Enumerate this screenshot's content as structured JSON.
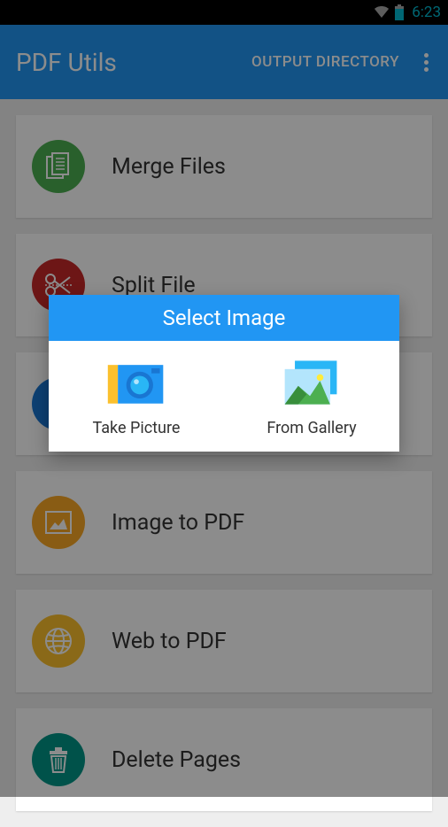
{
  "status": {
    "time": "6:23"
  },
  "header": {
    "title": "PDF Utils",
    "output_directory": "OUTPUT DIRECTORY"
  },
  "menu": {
    "items": [
      {
        "label": "Merge Files",
        "icon_color": "#4caf50",
        "icon": "merge"
      },
      {
        "label": "Split File",
        "icon_color": "#c62828",
        "icon": "split"
      },
      {
        "label": "",
        "icon_color": "#1976d2",
        "icon": "docx"
      },
      {
        "label": "Image to PDF",
        "icon_color": "#f9a825",
        "icon": "image"
      },
      {
        "label": "Web to PDF",
        "icon_color": "#fbc02d",
        "icon": "web"
      },
      {
        "label": "Delete Pages",
        "icon_color": "#009688",
        "icon": "delete"
      }
    ]
  },
  "dialog": {
    "title": "Select Image",
    "options": [
      {
        "label": "Take Picture"
      },
      {
        "label": "From Gallery"
      }
    ]
  }
}
